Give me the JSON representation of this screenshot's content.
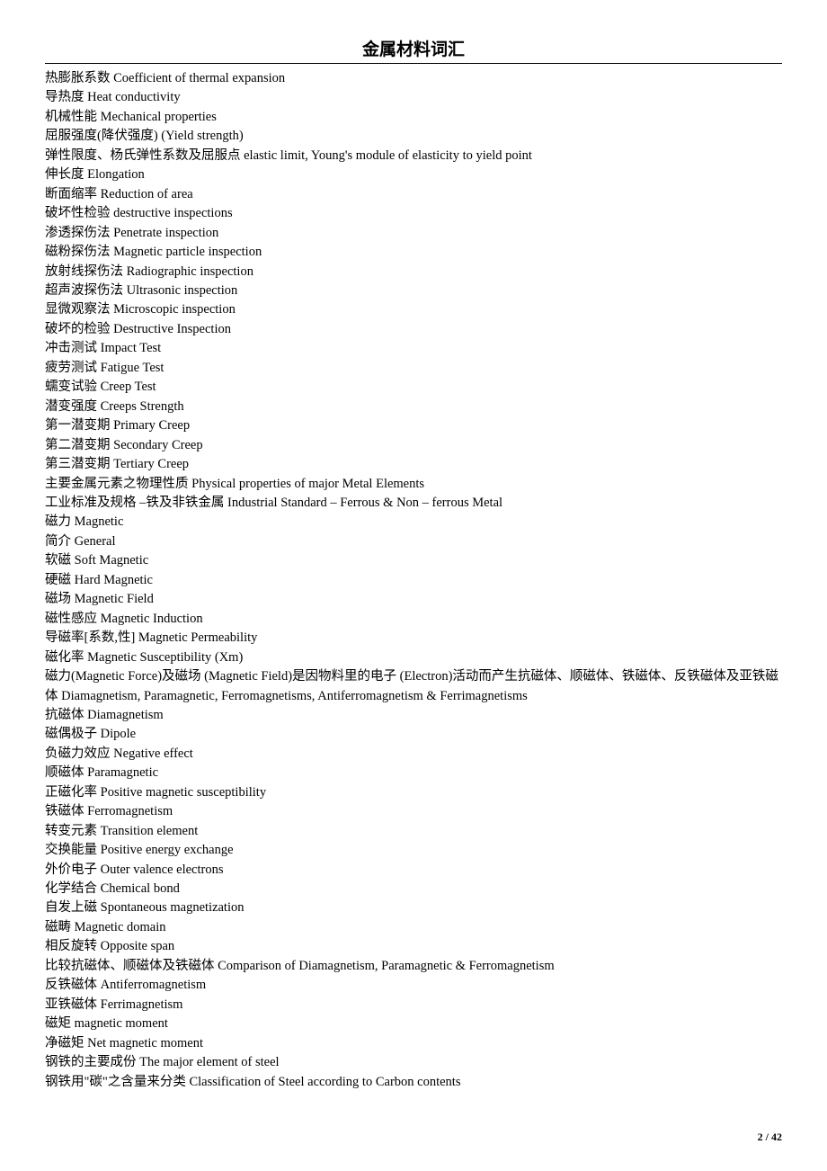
{
  "title": "金属材料词汇",
  "lines": [
    "热膨胀系数 Coefficient of thermal expansion",
    "导热度 Heat conductivity",
    "机械性能 Mechanical properties",
    "屈服强度(降伏强度) (Yield strength)",
    "弹性限度、杨氏弹性系数及屈服点 elastic limit, Young's module of elasticity to yield point",
    "伸长度 Elongation",
    "断面缩率 Reduction of area",
    "破坏性检验 destructive inspections",
    "渗透探伤法 Penetrate inspection",
    "磁粉探伤法 Magnetic particle inspection",
    "放射线探伤法 Radiographic inspection",
    "超声波探伤法 Ultrasonic inspection",
    "显微观察法 Microscopic inspection",
    "破坏的检验 Destructive Inspection",
    "冲击测试 Impact Test",
    "疲劳测试 Fatigue Test",
    "蠕变试验 Creep Test",
    "潜变强度 Creeps Strength",
    "第一潜变期 Primary Creep",
    "第二潜变期 Secondary Creep",
    "第三潜变期 Tertiary Creep",
    "主要金属元素之物理性质 Physical properties of major Metal Elements",
    "工业标准及规格 –铁及非铁金属 Industrial Standard – Ferrous & Non – ferrous Metal",
    "磁力 Magnetic",
    "简介 General",
    "软磁 Soft Magnetic",
    "硬磁 Hard Magnetic",
    "磁场 Magnetic Field",
    "磁性感应 Magnetic Induction",
    "导磁率[系数,性] Magnetic Permeability",
    "磁化率 Magnetic Susceptibility (Xm)",
    "磁力(Magnetic Force)及磁场 (Magnetic Field)是因物料里的电子 (Electron)活动而产生抗磁体、顺磁体、铁磁体、反铁磁体及亚铁磁体 Diamagnetism, Paramagnetic, Ferromagnetisms, Antiferromagnetism & Ferrimagnetisms",
    "抗磁体 Diamagnetism",
    "磁偶极子 Dipole",
    "负磁力效应 Negative effect",
    "顺磁体 Paramagnetic",
    "正磁化率 Positive magnetic susceptibility",
    "铁磁体 Ferromagnetism",
    "转变元素 Transition element",
    "交换能量 Positive energy exchange",
    "外价电子 Outer valence electrons",
    "化学结合 Chemical bond",
    "自发上磁 Spontaneous magnetization",
    "磁畴 Magnetic domain",
    "相反旋转 Opposite span",
    "比较抗磁体、顺磁体及铁磁体 Comparison of Diamagnetism, Paramagnetic & Ferromagnetism",
    "反铁磁体 Antiferromagnetism",
    "亚铁磁体 Ferrimagnetism",
    "磁矩 magnetic moment",
    "净磁矩 Net magnetic moment",
    "钢铁的主要成份 The major element of steel",
    "钢铁用\"碳\"之含量来分类 Classification of Steel according to Carbon contents"
  ],
  "footer": {
    "page": "2",
    "sep": " / ",
    "total": "42"
  }
}
